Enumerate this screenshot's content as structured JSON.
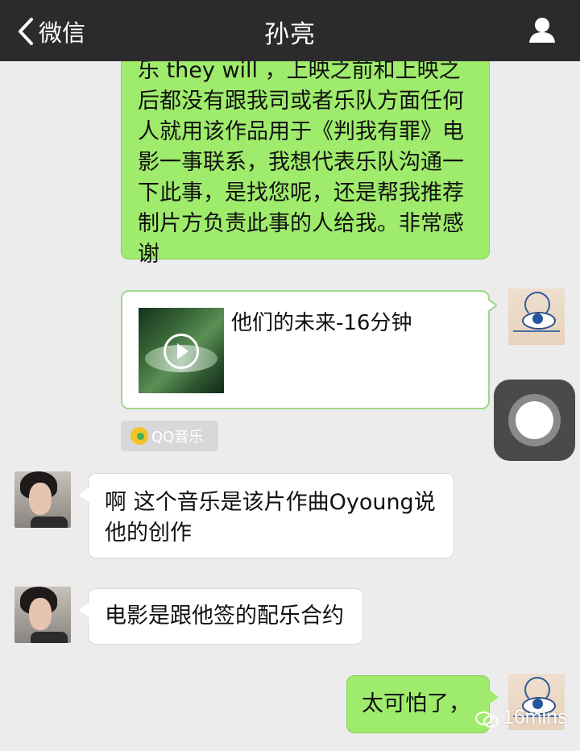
{
  "nav": {
    "back_label": "微信",
    "title": "孙亮",
    "profile_icon": "person-icon"
  },
  "messages": [
    {
      "sender": "self",
      "lines": [
        "乐 they will ，上映之前和上映之",
        "后都没有跟我司或者乐队方面任何",
        "人就用该作品用于《判我有罪》电",
        "影一事联系，我想代表乐队沟通一",
        "下此事，是找您呢，还是帮我推荐",
        "制片方负责此事的人给我。非常感",
        "谢"
      ]
    },
    {
      "sender": "self",
      "type": "music-card",
      "song_title": "他们的未来-16分钟",
      "source": "QQ音乐"
    },
    {
      "sender": "other",
      "lines": [
        "啊 这个音乐是该片作曲Oyoung说",
        "他的创作"
      ]
    },
    {
      "sender": "other",
      "lines": [
        "电影是跟他签的配乐合约"
      ]
    },
    {
      "sender": "self",
      "lines": [
        "太可怕了，"
      ]
    }
  ],
  "watermark": "16mins",
  "colors": {
    "nav_bg": "#2b2b2d",
    "self_bubble": "#9feb6c",
    "other_bubble": "#ffffff",
    "chat_bg": "#ececec"
  }
}
